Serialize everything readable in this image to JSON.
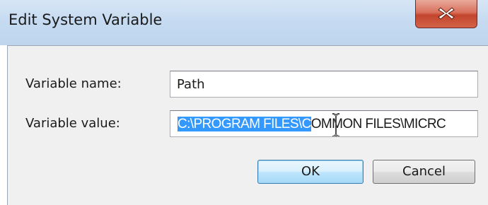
{
  "window": {
    "title": "Edit System Variable"
  },
  "fields": {
    "name_label": "Variable name:",
    "name_value": "Path",
    "value_label": "Variable value:",
    "value_selected_text": "C:\\PROGRAM FILES\\C",
    "value_rest_text": "OMMON FILES\\MICRC"
  },
  "buttons": {
    "ok_label": "OK",
    "cancel_label": "Cancel"
  },
  "icons": {
    "close": "close-x-icon",
    "cursor": "text-ibeam-cursor"
  },
  "colors": {
    "selection": "#3399ff",
    "close_button": "#c2442c",
    "titlebar": "#c6dbf1",
    "client_bg": "#f0f0f0"
  }
}
